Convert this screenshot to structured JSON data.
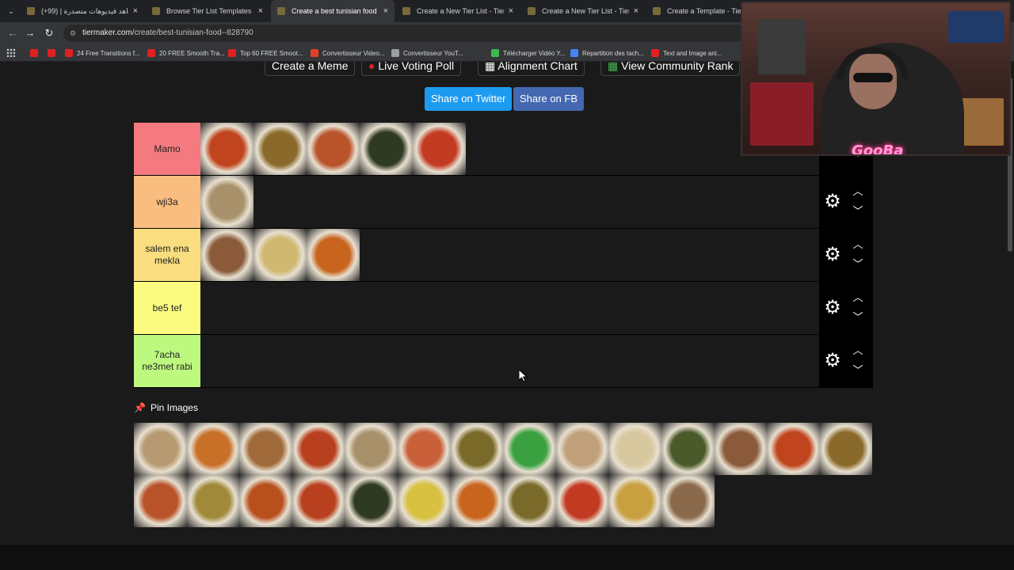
{
  "browser": {
    "tabs": [
      {
        "label": "شاهد فيديوهات متصدرة | (99+)",
        "active": false
      },
      {
        "label": "Browse Tier List Templates by C",
        "active": false
      },
      {
        "label": "Create a best tunisian food Tier",
        "active": true
      },
      {
        "label": "Create a New Tier List - TierMa",
        "active": false
      },
      {
        "label": "Create a New Tier List - TierMa",
        "active": false
      },
      {
        "label": "Create a Template - TierMa",
        "active": false
      }
    ],
    "url_host": "tiermaker.com",
    "url_path": "/create/best-tunisian-food--828790",
    "bookmarks": [
      "24 Free Transitions f...",
      "20 FREE Smooth Tra...",
      "Top 60 FREE Smoot...",
      "Convertisseur Video...",
      "Convertisseur YouT...",
      "Télécharger Vidéo Y...",
      "Repartition des tach...",
      "Text and Image ani..."
    ]
  },
  "page": {
    "top_buttons": [
      "Create a Meme",
      "Live Voting Poll",
      "Alignment Chart",
      "View Community Rank"
    ],
    "share_twitter": "Share on Twitter",
    "share_fb": "Share on FB",
    "tiers": [
      {
        "label": "Mamo",
        "color": "#f47a7f",
        "items": [
          "#c0451e",
          "#8a6a2a",
          "#b8532a",
          "#2f3a23",
          "#c33a22"
        ]
      },
      {
        "label": "wji3a",
        "color": "#f9bd7f",
        "items": [
          "#a8906a"
        ]
      },
      {
        "label": "salem ena mekla",
        "color": "#f9dd7f",
        "items": [
          "#8a5a3a",
          "#d0b870",
          "#c8641e"
        ]
      },
      {
        "label": "be5 tef",
        "color": "#fbfb7f",
        "items": []
      },
      {
        "label": "7acha ne3met rabi",
        "color": "#bdf97f",
        "items": []
      }
    ],
    "pin_title": "Pin Images",
    "pool": [
      "#b89a72",
      "#c87028",
      "#a06a3a",
      "#b8401e",
      "#a8906a",
      "#c8603a",
      "#7a6a2a",
      "#3aa040",
      "#c0a07a",
      "#d8c8a0",
      "#4a5a2a",
      "#8a5a3a",
      "#c0451e",
      "#8a6a2a",
      "#b8532a",
      "#a08a3a",
      "#b8501e",
      "#b8401e",
      "#2f3a23",
      "#d8c040",
      "#c8641e",
      "#7a6a2a",
      "#c33a22",
      "#c8a040",
      "#8a6a4a"
    ],
    "webcam_logo": "GooBa"
  }
}
